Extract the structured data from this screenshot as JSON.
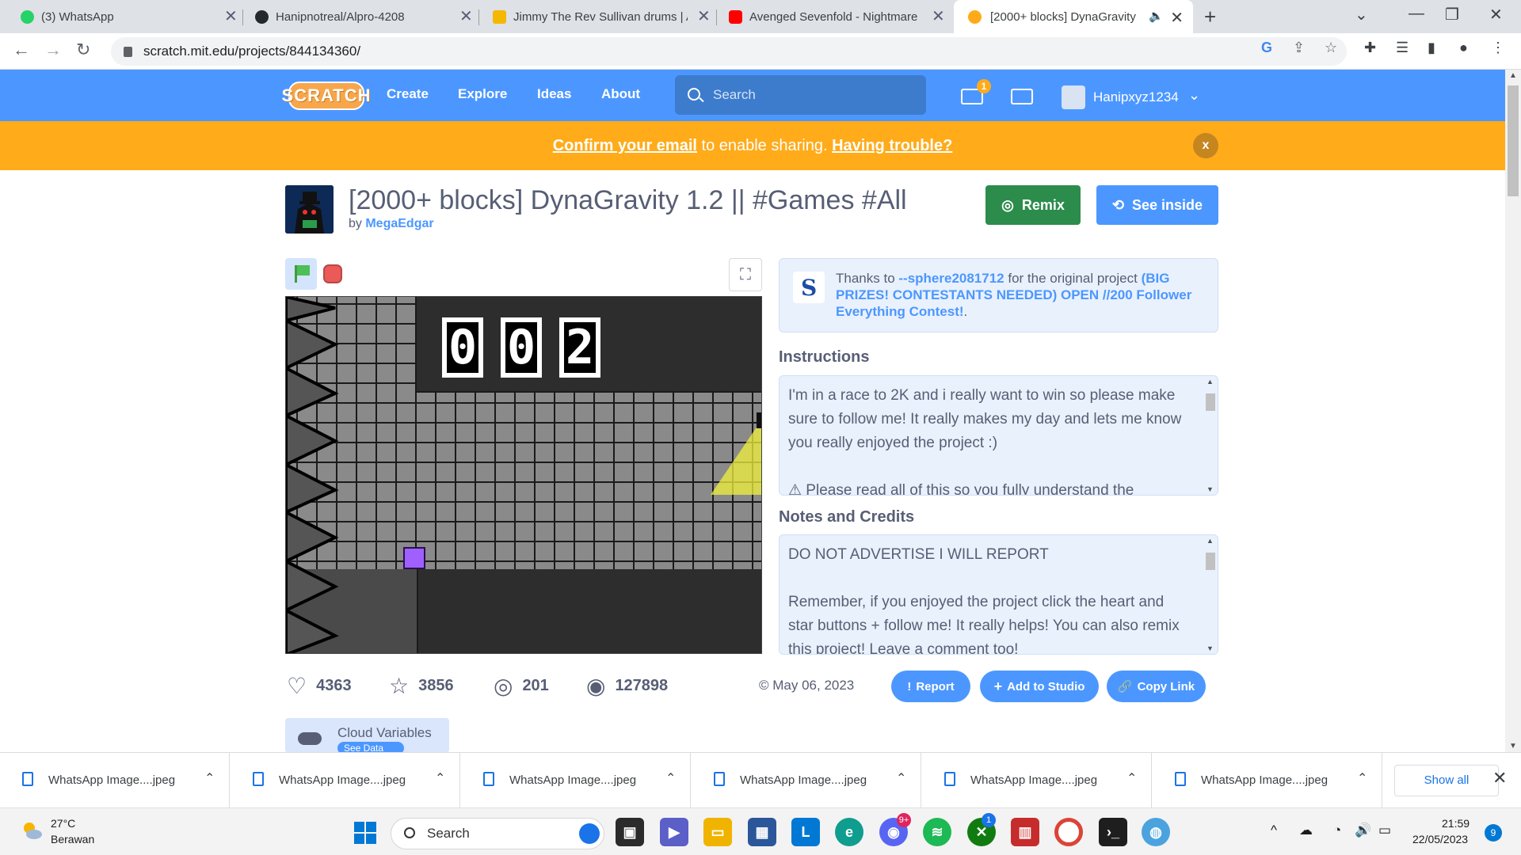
{
  "browser": {
    "tabs": [
      {
        "title": "(3) WhatsApp",
        "color": "#25d366"
      },
      {
        "title": "Hanipnotreal/Alpro-4208",
        "color": "#24292e"
      },
      {
        "title": "Jimmy The Rev Sullivan drums | A",
        "color": "#f5b800"
      },
      {
        "title": "Avenged Sevenfold - Nightmare",
        "color": "#ff0000"
      },
      {
        "title": "[2000+ blocks] DynaGravity",
        "color": "#ffab19",
        "active": true
      }
    ],
    "url": "scratch.mit.edu/projects/844134360/"
  },
  "nav": {
    "logo": "SCRATCH",
    "links": [
      "Create",
      "Explore",
      "Ideas",
      "About"
    ],
    "search_placeholder": "Search",
    "messages_count": "1",
    "username": "Hanipxyz1234"
  },
  "banner": {
    "link1": "Confirm your email",
    "middle": " to enable sharing. ",
    "link2": "Having trouble?",
    "close": "x"
  },
  "project": {
    "title": "[2000+ blocks] DynaGravity 1.2 || #Games #All",
    "by_prefix": "by ",
    "author": "MegaEdgar",
    "remix_label": "Remix",
    "see_inside_label": "See inside",
    "stage_digits": [
      "0",
      "0",
      "2"
    ],
    "stats": {
      "loves": "4363",
      "favorites": "3856",
      "remixes": "201",
      "views": "127898"
    },
    "shared_date": "May 06, 2023",
    "report_label": "Report",
    "add_to_studio_label": "Add to Studio",
    "copy_link_label": "Copy Link",
    "cloud_variables_title": "Cloud Variables",
    "cloud_variables_button": "See Data"
  },
  "credit": {
    "prefix": "Thanks to ",
    "user": "--sphere2081712",
    "middle": " for the original project ",
    "project": "(BIG PRIZES! CONTESTANTS NEEDED) OPEN //200 Follower Everything Contest!",
    "suffix": "."
  },
  "instructions": {
    "heading": "Instructions",
    "text": "I'm in a race to 2K and i really want to win so please make sure to follow me! It really makes my day and lets me know you really enjoyed the project :)\n\n⚠ Please read all of this so you fully understand the"
  },
  "notes": {
    "heading": "Notes and Credits",
    "text": "DO NOT ADVERTISE I WILL REPORT\n\nRemember, if you enjoyed the project click the heart and star buttons + follow me! It really helps! You can also remix this project! Leave a comment too!"
  },
  "downloads": {
    "items": [
      "WhatsApp Image....jpeg",
      "WhatsApp Image....jpeg",
      "WhatsApp Image....jpeg",
      "WhatsApp Image....jpeg",
      "WhatsApp Image....jpeg",
      "WhatsApp Image....jpeg"
    ],
    "show_all": "Show all"
  },
  "taskbar": {
    "temperature": "27°C",
    "weather": "Berawan",
    "search": "Search",
    "discord_badge": "9+",
    "xbox_badge": "1",
    "time": "21:59",
    "date": "22/05/2023",
    "notifications": "9"
  }
}
